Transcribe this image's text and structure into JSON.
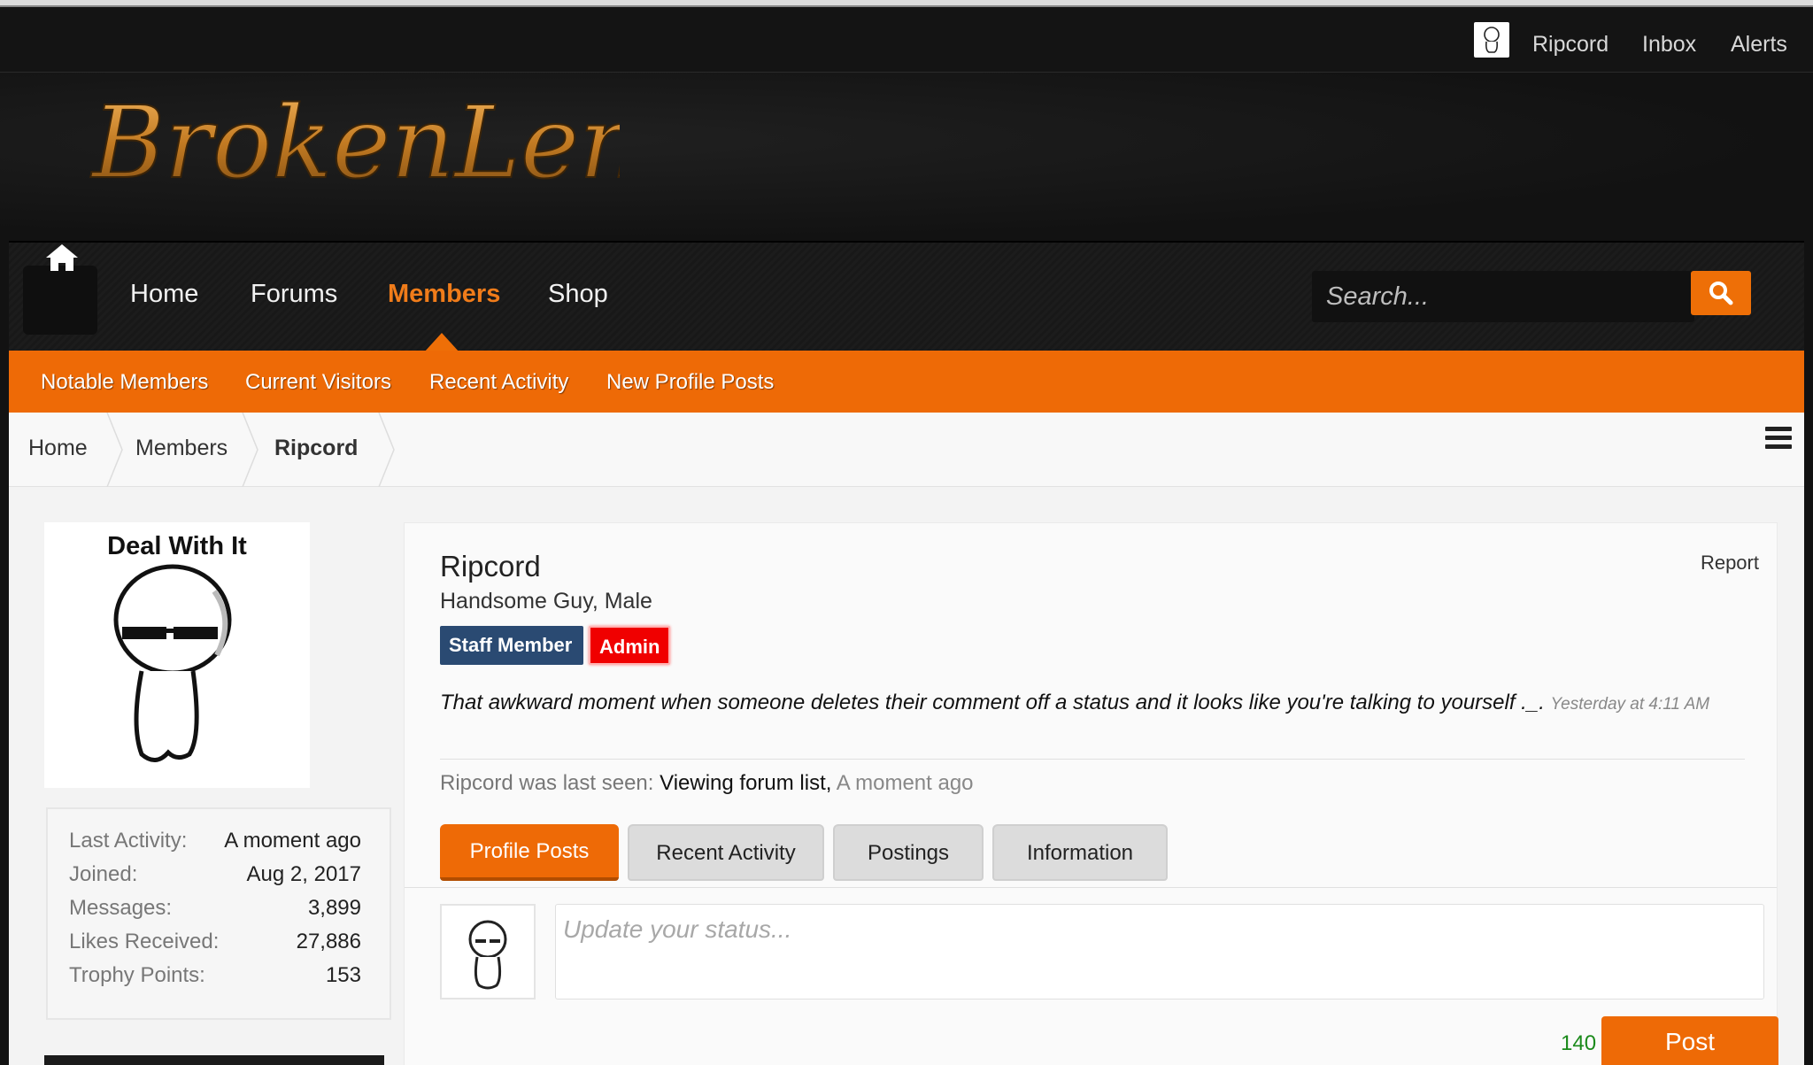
{
  "userbar": {
    "username": "Ripcord",
    "inbox": "Inbox",
    "alerts": "Alerts"
  },
  "logo": {
    "text": "BrokenLens"
  },
  "nav": {
    "items": [
      "Home",
      "Forums",
      "Members",
      "Shop"
    ],
    "active": "Members",
    "search_placeholder": "Search..."
  },
  "subnav": [
    "Notable Members",
    "Current Visitors",
    "Recent Activity",
    "New Profile Posts"
  ],
  "breadcrumb": [
    "Home",
    "Members",
    "Ripcord"
  ],
  "profile": {
    "avatar_caption": "Deal With It",
    "name": "Ripcord",
    "title": "Handsome Guy, Male",
    "badges": {
      "staff": "Staff Member",
      "admin": "Admin"
    },
    "report": "Report",
    "status": "That awkward moment when someone deletes their comment off a status and it looks like you're talking to yourself ._.",
    "status_time": "Yesterday at 4:11 AM",
    "last_seen_prefix": "Ripcord was last seen:",
    "last_seen_activity": "Viewing forum list,",
    "last_seen_when": "A moment ago"
  },
  "stats": [
    {
      "label": "Last Activity:",
      "value": "A moment ago"
    },
    {
      "label": "Joined:",
      "value": "Aug 2, 2017"
    },
    {
      "label": "Messages:",
      "value": "3,899"
    },
    {
      "label": "Likes Received:",
      "value": "27,886"
    },
    {
      "label": "Trophy Points:",
      "value": "153"
    }
  ],
  "tabs": [
    "Profile Posts",
    "Recent Activity",
    "Postings",
    "Information"
  ],
  "composer": {
    "placeholder": "Update your status...",
    "char_count": "140",
    "post": "Post"
  },
  "colors": {
    "accent": "#ee6a06",
    "staff_badge": "#2a4a72",
    "admin_badge": "#f00000",
    "char_count": "#1b8a1b"
  }
}
